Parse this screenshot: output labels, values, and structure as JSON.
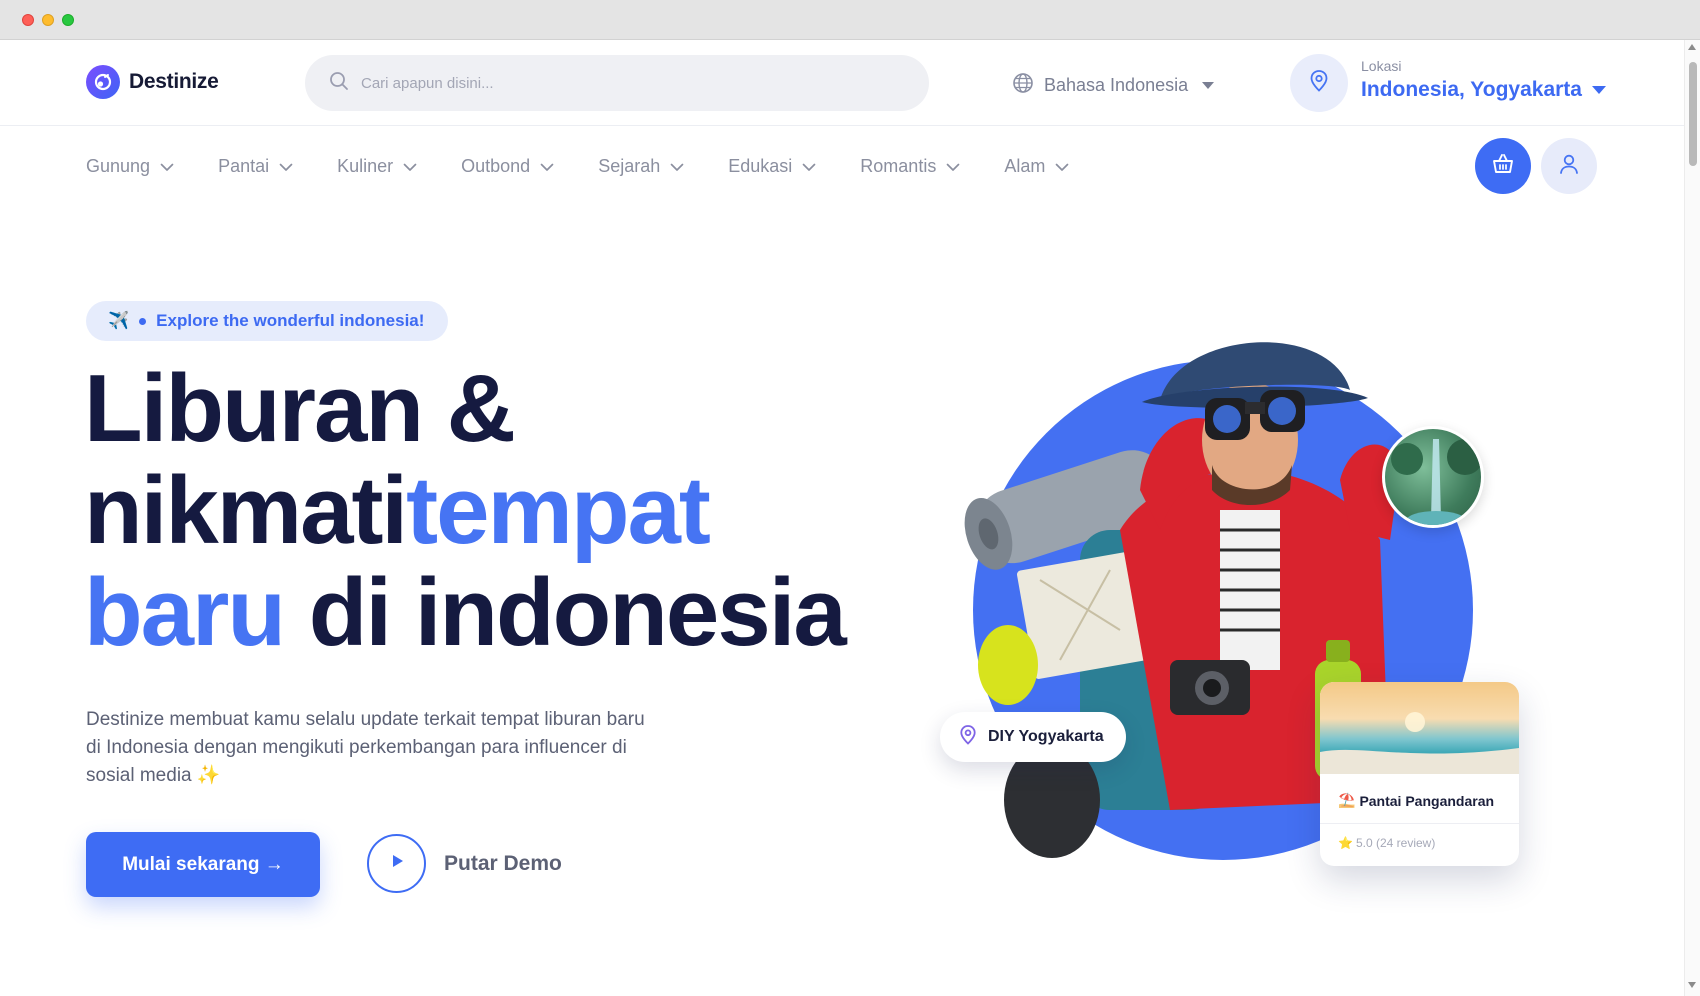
{
  "app": {
    "brand": "Destinize"
  },
  "header": {
    "search_placeholder": "Cari apapun disini...",
    "language": "Bahasa Indonesia",
    "location_label": "Lokasi",
    "location_value": "Indonesia, Yogyakarta"
  },
  "nav": {
    "items": [
      {
        "label": "Gunung"
      },
      {
        "label": "Pantai"
      },
      {
        "label": "Kuliner"
      },
      {
        "label": "Outbond"
      },
      {
        "label": "Sejarah"
      },
      {
        "label": "Edukasi"
      },
      {
        "label": "Romantis"
      },
      {
        "label": "Alam"
      }
    ]
  },
  "hero": {
    "badge": "Explore the wonderful indonesia!",
    "badge_emoji": "✈️",
    "headline": {
      "line1": "Liburan &",
      "line2_dark": "nikmati",
      "line2_blue": "tempat",
      "line3_blue": "baru",
      "line3_dark": " di indonesia"
    },
    "description": "Destinize membuat kamu selalu update terkait tempat liburan baru di Indonesia dengan mengikuti perkembangan para influencer di sosial media",
    "description_emoji": "✨",
    "cta_label": "Mulai sekarang →",
    "demo_label": "Putar Demo"
  },
  "illustration": {
    "pin_label": "DIY Yogyakarta",
    "card_emoji": "⛱️",
    "card_title": "Pantai Pangandaran",
    "card_star": "⭐",
    "card_rating": "5.0 (24 review)"
  },
  "colors": {
    "primary": "#3E6CF4",
    "headline_dark": "#151A40",
    "accent_blue": "#4674F3"
  },
  "icons": {
    "search": "search-icon",
    "globe": "globe-icon",
    "location": "location-pin-icon",
    "cart": "basket-icon",
    "user": "user-icon",
    "play": "play-icon"
  }
}
